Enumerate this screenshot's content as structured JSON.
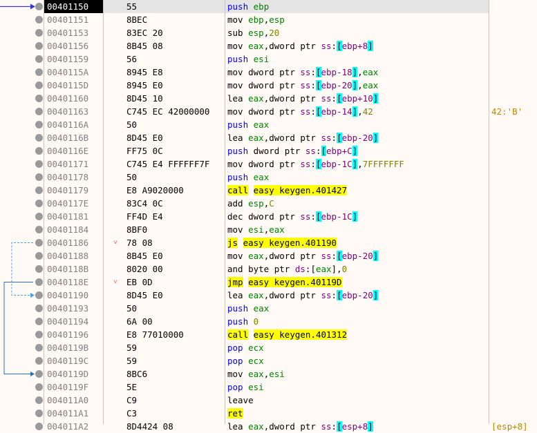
{
  "rows": [
    {
      "addr": "00401150",
      "bytes": "55",
      "arrow": "",
      "instr": [
        [
          "push",
          "mn-push"
        ],
        [
          " ",
          "plain"
        ],
        [
          "ebp",
          "reg"
        ]
      ],
      "comment": "",
      "selected": true
    },
    {
      "addr": "00401151",
      "bytes": "8BEC",
      "arrow": "",
      "instr": [
        [
          "mov",
          "mn-norm"
        ],
        [
          " ",
          "plain"
        ],
        [
          "ebp",
          "reg"
        ],
        [
          ",",
          "plain"
        ],
        [
          "esp",
          "reg"
        ]
      ],
      "comment": ""
    },
    {
      "addr": "00401153",
      "bytes": "83EC 20",
      "arrow": "",
      "instr": [
        [
          "sub",
          "mn-norm"
        ],
        [
          " ",
          "plain"
        ],
        [
          "esp",
          "reg"
        ],
        [
          ",",
          "plain"
        ],
        [
          "20",
          "num"
        ]
      ],
      "comment": ""
    },
    {
      "addr": "00401156",
      "bytes": "8B45 08",
      "arrow": "",
      "instr": [
        [
          "mov",
          "mn-norm"
        ],
        [
          " ",
          "plain"
        ],
        [
          "eax",
          "reg"
        ],
        [
          ",",
          "plain"
        ],
        [
          "dword ptr ",
          "sz"
        ],
        [
          "ss",
          "seg"
        ],
        [
          ":",
          "plain"
        ],
        [
          "[",
          "br"
        ],
        [
          "ebp+8",
          "seg"
        ],
        [
          "]",
          "br"
        ]
      ],
      "comment": ""
    },
    {
      "addr": "00401159",
      "bytes": "56",
      "arrow": "",
      "instr": [
        [
          "push",
          "mn-push"
        ],
        [
          " ",
          "plain"
        ],
        [
          "esi",
          "reg"
        ]
      ],
      "comment": ""
    },
    {
      "addr": "0040115A",
      "bytes": "8945 E8",
      "arrow": "",
      "instr": [
        [
          "mov",
          "mn-norm"
        ],
        [
          " ",
          "plain"
        ],
        [
          "dword ptr ",
          "sz"
        ],
        [
          "ss",
          "seg"
        ],
        [
          ":",
          "plain"
        ],
        [
          "[",
          "br"
        ],
        [
          "ebp-18",
          "seg"
        ],
        [
          "]",
          "br"
        ],
        [
          ",",
          "plain"
        ],
        [
          "eax",
          "reg"
        ]
      ],
      "comment": ""
    },
    {
      "addr": "0040115D",
      "bytes": "8945 E0",
      "arrow": "",
      "instr": [
        [
          "mov",
          "mn-norm"
        ],
        [
          " ",
          "plain"
        ],
        [
          "dword ptr ",
          "sz"
        ],
        [
          "ss",
          "seg"
        ],
        [
          ":",
          "plain"
        ],
        [
          "[",
          "br"
        ],
        [
          "ebp-20",
          "seg"
        ],
        [
          "]",
          "br"
        ],
        [
          ",",
          "plain"
        ],
        [
          "eax",
          "reg"
        ]
      ],
      "comment": ""
    },
    {
      "addr": "00401160",
      "bytes": "8D45 10",
      "arrow": "",
      "instr": [
        [
          "lea",
          "mn-norm"
        ],
        [
          " ",
          "plain"
        ],
        [
          "eax",
          "reg"
        ],
        [
          ",",
          "plain"
        ],
        [
          "dword ptr ",
          "sz"
        ],
        [
          "ss",
          "seg"
        ],
        [
          ":",
          "plain"
        ],
        [
          "[",
          "br"
        ],
        [
          "ebp+10",
          "seg"
        ],
        [
          "]",
          "br"
        ]
      ],
      "comment": ""
    },
    {
      "addr": "00401163",
      "bytes": "C745 EC 42000000",
      "arrow": "",
      "instr": [
        [
          "mov",
          "mn-norm"
        ],
        [
          " ",
          "plain"
        ],
        [
          "dword ptr ",
          "sz"
        ],
        [
          "ss",
          "seg"
        ],
        [
          ":",
          "plain"
        ],
        [
          "[",
          "br"
        ],
        [
          "ebp-14",
          "seg"
        ],
        [
          "]",
          "br"
        ],
        [
          ",",
          "plain"
        ],
        [
          "42",
          "num"
        ]
      ],
      "comment": "42:'B'"
    },
    {
      "addr": "0040116A",
      "bytes": "50",
      "arrow": "",
      "instr": [
        [
          "push",
          "mn-push"
        ],
        [
          " ",
          "plain"
        ],
        [
          "eax",
          "reg"
        ]
      ],
      "comment": ""
    },
    {
      "addr": "0040116B",
      "bytes": "8D45 E0",
      "arrow": "",
      "instr": [
        [
          "lea",
          "mn-norm"
        ],
        [
          " ",
          "plain"
        ],
        [
          "eax",
          "reg"
        ],
        [
          ",",
          "plain"
        ],
        [
          "dword ptr ",
          "sz"
        ],
        [
          "ss",
          "seg"
        ],
        [
          ":",
          "plain"
        ],
        [
          "[",
          "br"
        ],
        [
          "ebp-20",
          "seg"
        ],
        [
          "]",
          "br"
        ]
      ],
      "comment": ""
    },
    {
      "addr": "0040116E",
      "bytes": "FF75 0C",
      "arrow": "",
      "instr": [
        [
          "push",
          "mn-push"
        ],
        [
          " ",
          "plain"
        ],
        [
          "dword ptr ",
          "sz"
        ],
        [
          "ss",
          "seg"
        ],
        [
          ":",
          "plain"
        ],
        [
          "[",
          "br"
        ],
        [
          "ebp+C",
          "seg"
        ],
        [
          "]",
          "br"
        ]
      ],
      "comment": ""
    },
    {
      "addr": "00401171",
      "bytes": "C745 E4 FFFFFF7F",
      "arrow": "",
      "instr": [
        [
          "mov",
          "mn-norm"
        ],
        [
          " ",
          "plain"
        ],
        [
          "dword ptr ",
          "sz"
        ],
        [
          "ss",
          "seg"
        ],
        [
          ":",
          "plain"
        ],
        [
          "[",
          "br"
        ],
        [
          "ebp-1C",
          "seg"
        ],
        [
          "]",
          "br"
        ],
        [
          ",",
          "plain"
        ],
        [
          "7FFFFFFF",
          "num"
        ]
      ],
      "comment": ""
    },
    {
      "addr": "00401178",
      "bytes": "50",
      "arrow": "",
      "instr": [
        [
          "push",
          "mn-push"
        ],
        [
          " ",
          "plain"
        ],
        [
          "eax",
          "reg"
        ]
      ],
      "comment": ""
    },
    {
      "addr": "00401179",
      "bytes": "E8 A9020000",
      "arrow": "",
      "instr": [
        [
          "call",
          "mn-cf"
        ],
        [
          " ",
          "plain"
        ],
        [
          "easy keygen.401427",
          "tgt"
        ]
      ],
      "comment": ""
    },
    {
      "addr": "0040117E",
      "bytes": "83C4 0C",
      "arrow": "",
      "instr": [
        [
          "add",
          "mn-norm"
        ],
        [
          " ",
          "plain"
        ],
        [
          "esp",
          "reg"
        ],
        [
          ",",
          "plain"
        ],
        [
          "C",
          "num"
        ]
      ],
      "comment": ""
    },
    {
      "addr": "00401181",
      "bytes": "FF4D E4",
      "arrow": "",
      "instr": [
        [
          "dec",
          "mn-norm"
        ],
        [
          " ",
          "plain"
        ],
        [
          "dword ptr ",
          "sz"
        ],
        [
          "ss",
          "seg"
        ],
        [
          ":",
          "plain"
        ],
        [
          "[",
          "br"
        ],
        [
          "ebp-1C",
          "seg"
        ],
        [
          "]",
          "br"
        ]
      ],
      "comment": ""
    },
    {
      "addr": "00401184",
      "bytes": "8BF0",
      "arrow": "",
      "instr": [
        [
          "mov",
          "mn-norm"
        ],
        [
          " ",
          "plain"
        ],
        [
          "esi",
          "reg"
        ],
        [
          ",",
          "plain"
        ],
        [
          "eax",
          "reg"
        ]
      ],
      "comment": ""
    },
    {
      "addr": "00401186",
      "bytes": "78 08",
      "arrow": "˅",
      "instr": [
        [
          "js",
          "mn-cf"
        ],
        [
          " ",
          "plain"
        ],
        [
          "easy keygen.401190",
          "tgt"
        ]
      ],
      "comment": ""
    },
    {
      "addr": "00401188",
      "bytes": "8B45 E0",
      "arrow": "",
      "instr": [
        [
          "mov",
          "mn-norm"
        ],
        [
          " ",
          "plain"
        ],
        [
          "eax",
          "reg"
        ],
        [
          ",",
          "plain"
        ],
        [
          "dword ptr ",
          "sz"
        ],
        [
          "ss",
          "seg"
        ],
        [
          ":",
          "plain"
        ],
        [
          "[",
          "br"
        ],
        [
          "ebp-20",
          "seg"
        ],
        [
          "]",
          "br"
        ]
      ],
      "comment": ""
    },
    {
      "addr": "0040118B",
      "bytes": "8020 00",
      "arrow": "",
      "instr": [
        [
          "and",
          "mn-norm"
        ],
        [
          " ",
          "plain"
        ],
        [
          "byte ptr ",
          "sz"
        ],
        [
          "ds",
          "seg"
        ],
        [
          ":",
          "plain"
        ],
        [
          "[",
          "plain"
        ],
        [
          "eax",
          "reg"
        ],
        [
          "]",
          "plain"
        ],
        [
          ",",
          "plain"
        ],
        [
          "0",
          "num"
        ]
      ],
      "comment": ""
    },
    {
      "addr": "0040118E",
      "bytes": "EB 0D",
      "arrow": "˅",
      "instr": [
        [
          "jmp",
          "mn-cf"
        ],
        [
          " ",
          "plain"
        ],
        [
          "easy keygen.40119D",
          "tgt"
        ]
      ],
      "comment": ""
    },
    {
      "addr": "00401190",
      "bytes": "8D45 E0",
      "arrow": "",
      "instr": [
        [
          "lea",
          "mn-norm"
        ],
        [
          " ",
          "plain"
        ],
        [
          "eax",
          "reg"
        ],
        [
          ",",
          "plain"
        ],
        [
          "dword ptr ",
          "sz"
        ],
        [
          "ss",
          "seg"
        ],
        [
          ":",
          "plain"
        ],
        [
          "[",
          "br"
        ],
        [
          "ebp-20",
          "seg"
        ],
        [
          "]",
          "br"
        ]
      ],
      "comment": ""
    },
    {
      "addr": "00401193",
      "bytes": "50",
      "arrow": "",
      "instr": [
        [
          "push",
          "mn-push"
        ],
        [
          " ",
          "plain"
        ],
        [
          "eax",
          "reg"
        ]
      ],
      "comment": ""
    },
    {
      "addr": "00401194",
      "bytes": "6A 00",
      "arrow": "",
      "instr": [
        [
          "push",
          "mn-push"
        ],
        [
          " ",
          "plain"
        ],
        [
          "0",
          "num"
        ]
      ],
      "comment": ""
    },
    {
      "addr": "00401196",
      "bytes": "E8 77010000",
      "arrow": "",
      "instr": [
        [
          "call",
          "mn-cf"
        ],
        [
          " ",
          "plain"
        ],
        [
          "easy keygen.401312",
          "tgt"
        ]
      ],
      "comment": ""
    },
    {
      "addr": "0040119B",
      "bytes": "59",
      "arrow": "",
      "instr": [
        [
          "pop",
          "mn-push"
        ],
        [
          " ",
          "plain"
        ],
        [
          "ecx",
          "reg"
        ]
      ],
      "comment": ""
    },
    {
      "addr": "0040119C",
      "bytes": "59",
      "arrow": "",
      "instr": [
        [
          "pop",
          "mn-push"
        ],
        [
          " ",
          "plain"
        ],
        [
          "ecx",
          "reg"
        ]
      ],
      "comment": ""
    },
    {
      "addr": "0040119D",
      "bytes": "8BC6",
      "arrow": "",
      "instr": [
        [
          "mov",
          "mn-norm"
        ],
        [
          " ",
          "plain"
        ],
        [
          "eax",
          "reg"
        ],
        [
          ",",
          "plain"
        ],
        [
          "esi",
          "reg"
        ]
      ],
      "comment": ""
    },
    {
      "addr": "0040119F",
      "bytes": "5E",
      "arrow": "",
      "instr": [
        [
          "pop",
          "mn-push"
        ],
        [
          " ",
          "plain"
        ],
        [
          "esi",
          "reg"
        ]
      ],
      "comment": ""
    },
    {
      "addr": "004011A0",
      "bytes": "C9",
      "arrow": "",
      "instr": [
        [
          "leave",
          "mn-norm"
        ]
      ],
      "comment": ""
    },
    {
      "addr": "004011A1",
      "bytes": "C3",
      "arrow": "",
      "instr": [
        [
          "ret",
          "mn-cf"
        ]
      ],
      "comment": ""
    },
    {
      "addr": "004011A2",
      "bytes": "8D4424 08",
      "arrow": "",
      "instr": [
        [
          "lea",
          "mn-norm"
        ],
        [
          " ",
          "plain"
        ],
        [
          "eax",
          "reg"
        ],
        [
          ",",
          "plain"
        ],
        [
          "dword ptr ",
          "sz"
        ],
        [
          "ss",
          "seg"
        ],
        [
          ":",
          "plain"
        ],
        [
          "[",
          "br"
        ],
        [
          "esp+8",
          "seg"
        ],
        [
          "]",
          "br"
        ]
      ],
      "comment": "[esp+8]"
    }
  ],
  "colors": {
    "eip_arrow": "#3a3ad6",
    "jump_line": "#2a70b8",
    "jump_dashed": "#4aa0e0",
    "breakpoint": "#9a9a9a"
  }
}
